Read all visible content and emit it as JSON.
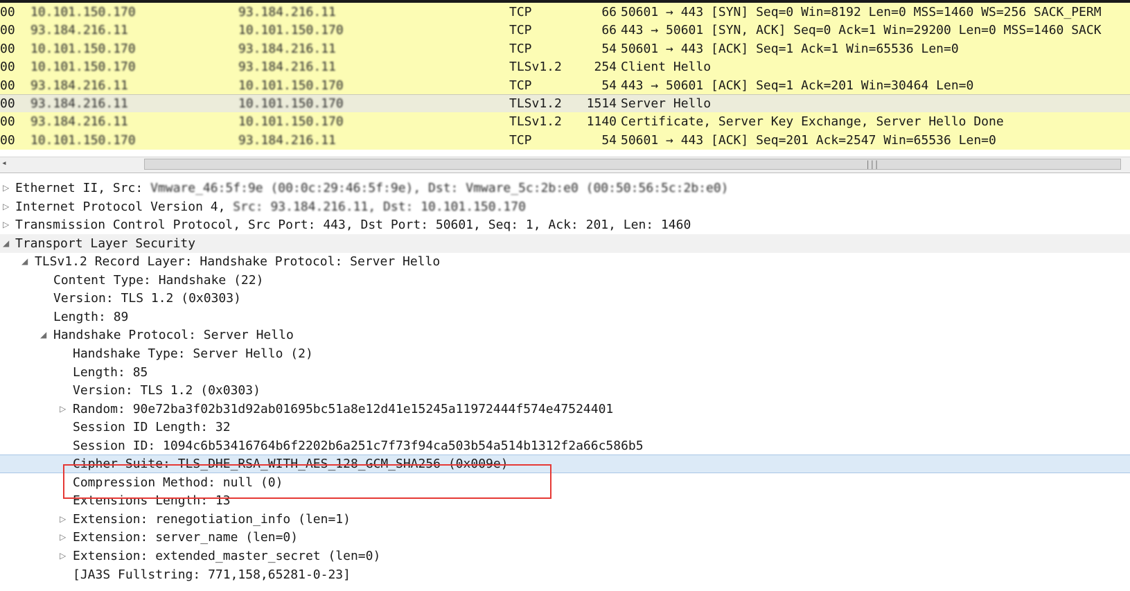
{
  "packet_list": {
    "rows": [
      {
        "time": "00",
        "src": "10.101.150.170",
        "dst": "93.184.216.11",
        "proto": "TCP",
        "len": "66",
        "info": "50601 → 443 [SYN] Seq=0 Win=8192 Len=0 MSS=1460 WS=256 SACK_PERM",
        "selected": false
      },
      {
        "time": "00",
        "src": "93.184.216.11",
        "dst": "10.101.150.170",
        "proto": "TCP",
        "len": "66",
        "info": "443 → 50601 [SYN, ACK] Seq=0 Ack=1 Win=29200 Len=0 MSS=1460 SACK",
        "selected": false
      },
      {
        "time": "00",
        "src": "10.101.150.170",
        "dst": "93.184.216.11",
        "proto": "TCP",
        "len": "54",
        "info": "50601 → 443 [ACK] Seq=1 Ack=1 Win=65536 Len=0",
        "selected": false
      },
      {
        "time": "00",
        "src": "10.101.150.170",
        "dst": "93.184.216.11",
        "proto": "TLSv1.2",
        "len": "254",
        "info": "Client Hello",
        "selected": false
      },
      {
        "time": "00",
        "src": "93.184.216.11",
        "dst": "10.101.150.170",
        "proto": "TCP",
        "len": "54",
        "info": "443 → 50601 [ACK] Seq=1 Ack=201 Win=30464 Len=0",
        "selected": false
      },
      {
        "time": "00",
        "src": "93.184.216.11",
        "dst": "10.101.150.170",
        "proto": "TLSv1.2",
        "len": "1514",
        "info": "Server Hello",
        "selected": true
      },
      {
        "time": "00",
        "src": "93.184.216.11",
        "dst": "10.101.150.170",
        "proto": "TLSv1.2",
        "len": "1140",
        "info": "Certificate, Server Key Exchange, Server Hello Done",
        "selected": false
      },
      {
        "time": "00",
        "src": "10.101.150.170",
        "dst": "93.184.216.11",
        "proto": "TCP",
        "len": "54",
        "info": "50601 → 443 [ACK] Seq=201 Ack=2547 Win=65536 Len=0",
        "selected": false
      }
    ]
  },
  "scrollbar": {
    "left_arrow": "◂",
    "grip": "|||"
  },
  "details": {
    "rows": [
      {
        "text": "Ethernet II, Src: Vmware_46:5f:9e (00:0c:29:46:5f:9e), Dst: Vmware_5c:2b:e0 (00:50:56:5c:2b:e0)",
        "toggle": "▷",
        "level": 0,
        "blur_after": "Ethernet II, Src: ",
        "state": "collapsed"
      },
      {
        "text": "Internet Protocol Version 4, Src: 93.184.216.11, Dst: 10.101.150.170",
        "toggle": "▷",
        "level": 0,
        "blur_after": "Internet Protocol Version 4, ",
        "state": "collapsed"
      },
      {
        "text": "Transmission Control Protocol, Src Port: 443, Dst Port: 50601, Seq: 1, Ack: 201, Len: 1460",
        "toggle": "▷",
        "level": 0,
        "state": "collapsed"
      },
      {
        "text": "Transport Layer Security",
        "toggle": "◢",
        "level": 0,
        "state": "expanded",
        "highlight": true
      },
      {
        "text": "TLSv1.2 Record Layer: Handshake Protocol: Server Hello",
        "toggle": "◢",
        "level": 1,
        "state": "expanded"
      },
      {
        "text": "Content Type: Handshake (22)",
        "toggle": "",
        "level": 2
      },
      {
        "text": "Version: TLS 1.2 (0x0303)",
        "toggle": "",
        "level": 2
      },
      {
        "text": "Length: 89",
        "toggle": "",
        "level": 2
      },
      {
        "text": "Handshake Protocol: Server Hello",
        "toggle": "◢",
        "level": 2,
        "state": "expanded"
      },
      {
        "text": "Handshake Type: Server Hello (2)",
        "toggle": "",
        "level": 3
      },
      {
        "text": "Length: 85",
        "toggle": "",
        "level": 3
      },
      {
        "text": "Version: TLS 1.2 (0x0303)",
        "toggle": "",
        "level": 3
      },
      {
        "text": "Random: 90e72ba3f02b31d92ab01695bc51a8e12d41e15245a11972444f574e47524401",
        "toggle": "▷",
        "level": 3,
        "state": "collapsed"
      },
      {
        "text": "Session ID Length: 32",
        "toggle": "",
        "level": 3
      },
      {
        "text": "Session ID: 1094c6b53416764b6f2202b6a251c7f73f94ca503b54a514b1312f2a66c586b5",
        "toggle": "",
        "level": 3
      },
      {
        "text": "Cipher Suite: TLS_DHE_RSA_WITH_AES_128_GCM_SHA256 (0x009e)",
        "toggle": "",
        "level": 3,
        "selected": true
      },
      {
        "text": "Compression Method: null (0)",
        "toggle": "",
        "level": 3
      },
      {
        "text": "Extensions Length: 13",
        "toggle": "",
        "level": 3
      },
      {
        "text": "Extension: renegotiation_info (len=1)",
        "toggle": "▷",
        "level": 3,
        "state": "collapsed"
      },
      {
        "text": "Extension: server_name (len=0)",
        "toggle": "▷",
        "level": 3,
        "state": "collapsed"
      },
      {
        "text": "Extension: extended_master_secret (len=0)",
        "toggle": "▷",
        "level": 3,
        "state": "collapsed"
      },
      {
        "text": "[JA3S Fullstring: 771,158,65281-0-23]",
        "toggle": "",
        "level": 3
      }
    ]
  },
  "colors": {
    "packet_row_bg": "#fcfcb4",
    "packet_selected_bg": "#ececda",
    "detail_selected_bg": "#dceaf7",
    "annotation_border": "#e53935"
  }
}
